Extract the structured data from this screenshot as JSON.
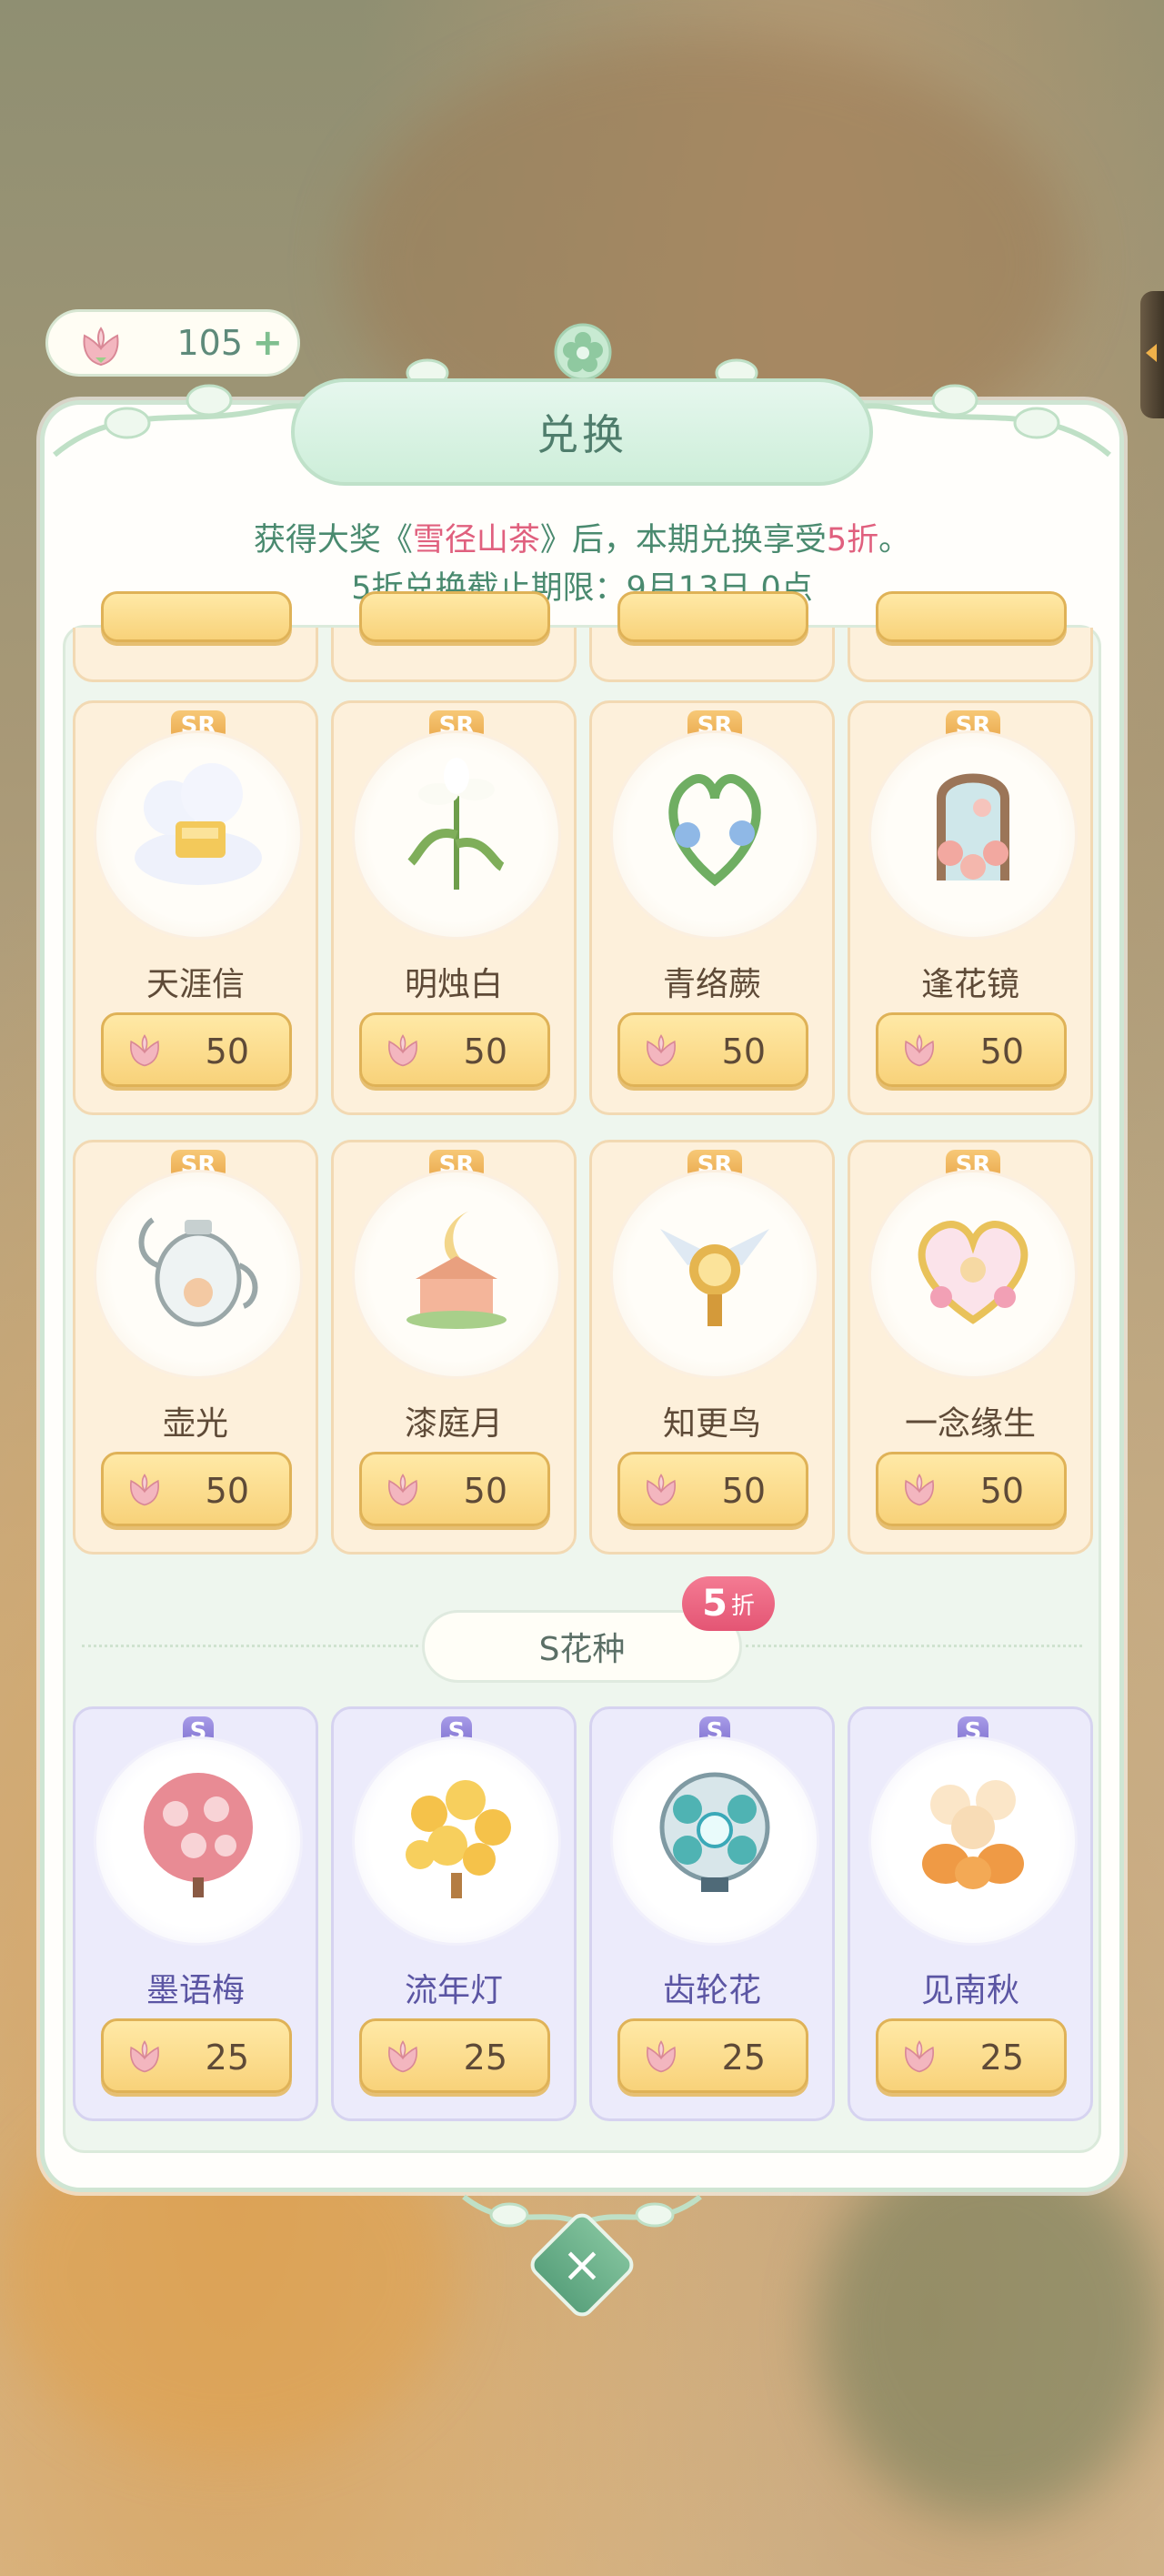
{
  "currency": {
    "amount": "105",
    "plus": "+",
    "icon": "camellia-petal-icon"
  },
  "dialog": {
    "title": "兑换",
    "notice_prefix": "获得大奖《",
    "notice_prize": "雪径山茶",
    "notice_middle": "》后，本期兑换享受",
    "notice_discount": "5折",
    "notice_suffix": "。",
    "deadline": "5折兑换截止期限：9月13日 0点"
  },
  "sr_items": [
    {
      "badge": "SR",
      "name": "天涯信",
      "price": "50"
    },
    {
      "badge": "SR",
      "name": "明烛白",
      "price": "50"
    },
    {
      "badge": "SR",
      "name": "青络蕨",
      "price": "50"
    },
    {
      "badge": "SR",
      "name": "逢花镜",
      "price": "50"
    },
    {
      "badge": "SR",
      "name": "壶光",
      "price": "50"
    },
    {
      "badge": "SR",
      "name": "漆庭月",
      "price": "50"
    },
    {
      "badge": "SR",
      "name": "知更鸟",
      "price": "50"
    },
    {
      "badge": "SR",
      "name": "一念缘生",
      "price": "50"
    }
  ],
  "s_section": {
    "title": "S花种",
    "discount_num": "5",
    "discount_unit": "折"
  },
  "s_items": [
    {
      "badge": "S",
      "name": "墨语梅",
      "price": "25"
    },
    {
      "badge": "S",
      "name": "流年灯",
      "price": "25"
    },
    {
      "badge": "S",
      "name": "齿轮花",
      "price": "25"
    },
    {
      "badge": "S",
      "name": "见南秋",
      "price": "25"
    }
  ],
  "close_label": "×",
  "colors": {
    "accent": "#e0607e",
    "panel_border": "#cfe5d3",
    "price_button": "#f8d27a"
  }
}
